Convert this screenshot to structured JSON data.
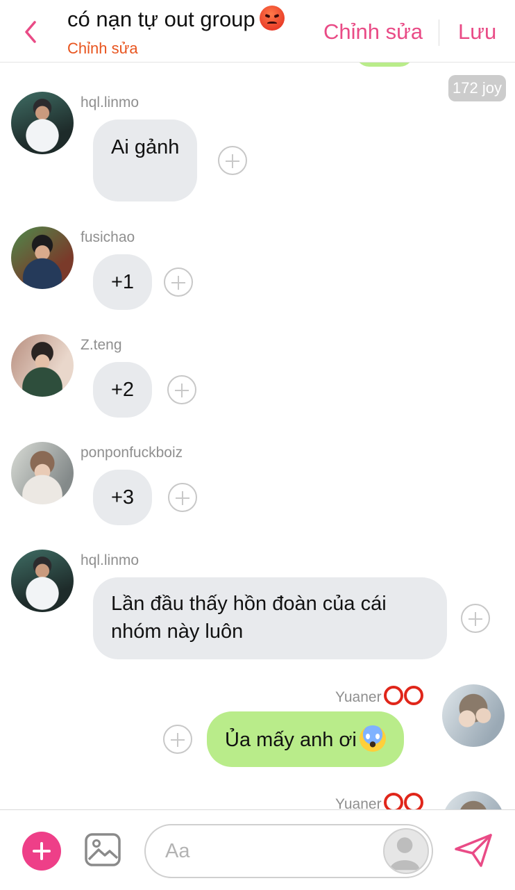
{
  "header": {
    "title": "có nạn tự out group",
    "title_emoji": "angry-face",
    "subtitle": "Chỉnh sửa",
    "edit_label": "Chỉnh sửa",
    "save_label": "Lưu"
  },
  "likes_badge": "172 joy",
  "messages": [
    {
      "sender": "hql.linmo",
      "text": "Ai gảnh",
      "direction": "in"
    },
    {
      "sender": "fusichao",
      "text": "+1",
      "direction": "in"
    },
    {
      "sender": "Z.teng",
      "text": "+2",
      "direction": "in"
    },
    {
      "sender": "ponponfuckboiz",
      "text": "+3",
      "direction": "in"
    },
    {
      "sender": "hql.linmo",
      "text_line1": "Lần đầu thấy hồn đoàn của cái",
      "text_line2": "nhóm này luôn",
      "direction": "in"
    },
    {
      "sender": "Yuaner",
      "text": "Ủa mấy anh ơi",
      "emoji": "face-screaming",
      "direction": "out"
    },
    {
      "sender": "Yuaner",
      "direction": "out"
    }
  ],
  "composer": {
    "placeholder": "Aa"
  },
  "colors": {
    "accent": "#E94B86",
    "subtitle": "#E8541E",
    "outgoing_bubble": "#B9EC8A",
    "incoming_bubble": "#E8EAED",
    "add_button": "#EE3F88"
  },
  "icons": [
    "back-chevron-icon",
    "angry-face-icon",
    "plus-icon",
    "image-gallery-icon",
    "send-icon",
    "user-avatar-icon",
    "add-reaction-icon"
  ]
}
